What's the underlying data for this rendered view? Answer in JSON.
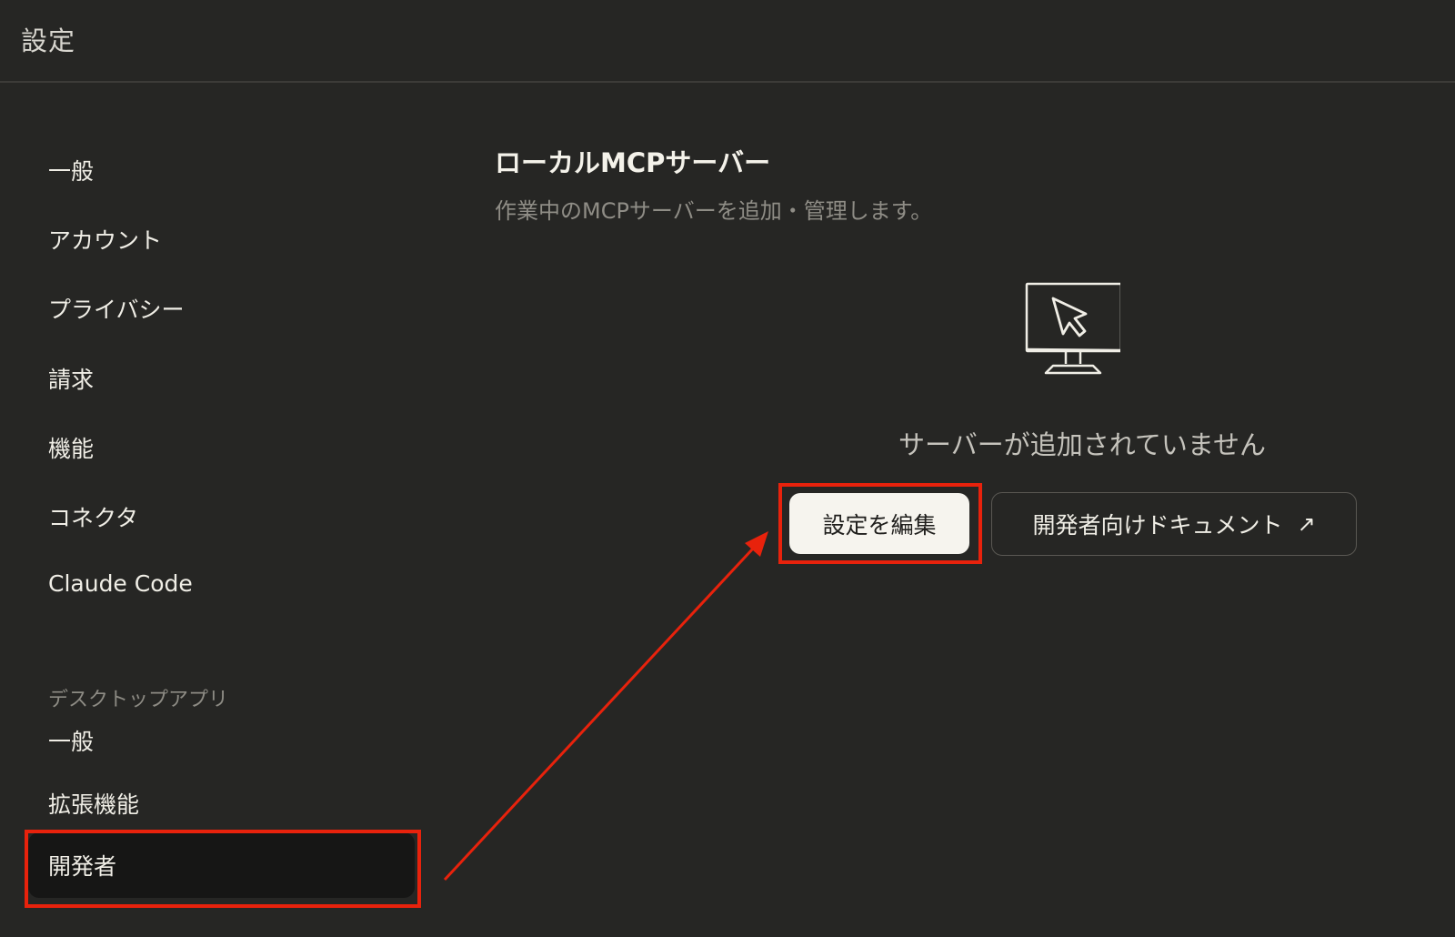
{
  "window": {
    "title": "設定"
  },
  "sidebar": {
    "items": [
      {
        "label": "一般"
      },
      {
        "label": "アカウント"
      },
      {
        "label": "プライバシー"
      },
      {
        "label": "請求"
      },
      {
        "label": "機能"
      },
      {
        "label": "コネクタ"
      },
      {
        "label": "Claude Code"
      }
    ],
    "desktop_section": {
      "label": "デスクトップアプリ",
      "items": [
        {
          "label": "一般"
        },
        {
          "label": "拡張機能"
        },
        {
          "label": "開発者",
          "active": true
        }
      ]
    }
  },
  "main": {
    "title": "ローカルMCPサーバー",
    "subtitle": "作業中のMCPサーバーを追加・管理します。",
    "empty_state": {
      "icon": "monitor-cursor-icon",
      "text": "サーバーが追加されていません"
    },
    "buttons": {
      "edit_config": "設定を編集",
      "developer_docs": "開発者向けドキュメント",
      "docs_arrow": "↗"
    }
  },
  "annotation": {
    "color": "#e8220c"
  }
}
